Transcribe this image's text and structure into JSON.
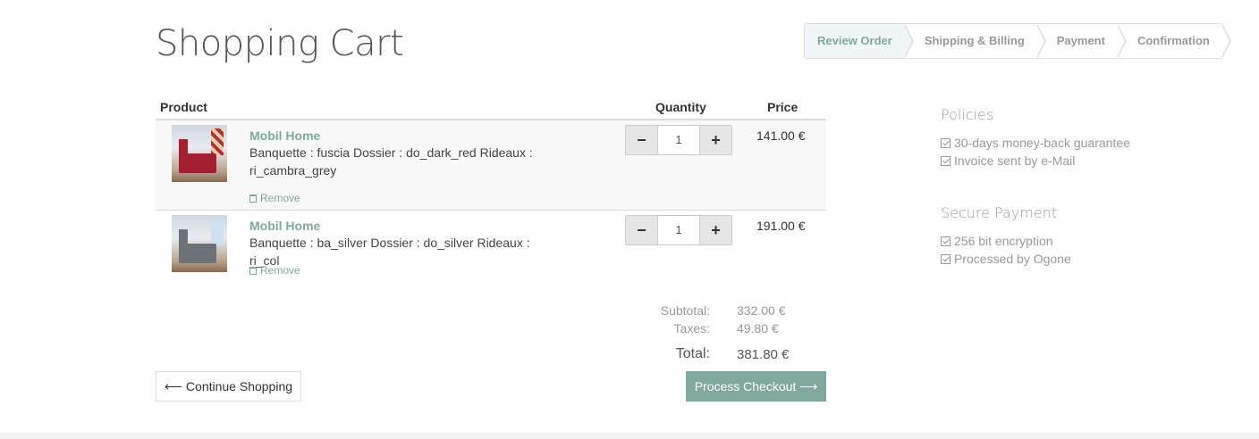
{
  "page": {
    "title": "Shopping Cart"
  },
  "wizard": {
    "steps": [
      "Review Order",
      "Shipping & Billing",
      "Payment",
      "Confirmation"
    ]
  },
  "table": {
    "headers": {
      "product": "Product",
      "quantity": "Quantity",
      "price": "Price"
    }
  },
  "items": [
    {
      "name": "Mobil Home",
      "description": "Banquette : fuscia Dossier : do_dark_red Rideaux : ri_cambra_grey",
      "quantity": "1",
      "price": "141.00 €",
      "remove_label": "Remove"
    },
    {
      "name": "Mobil Home",
      "description": "Banquette : ba_silver Dossier : do_silver Rideaux : ri_col",
      "quantity": "1",
      "price": "191.00 €",
      "remove_label": "Remove"
    }
  ],
  "totals": {
    "subtotal_label": "Subtotal:",
    "subtotal": "332.00 €",
    "taxes_label": "Taxes:",
    "taxes": "49.80 €",
    "total_label": "Total:",
    "total": "381.80 €"
  },
  "buttons": {
    "continue": "⟵ Continue Shopping",
    "checkout": "Process Checkout ⟶"
  },
  "side": {
    "policies_title": "Policies",
    "policies": [
      "30-days money-back guarantee",
      "Invoice sent by e-Mail"
    ],
    "payment_title": "Secure Payment",
    "payment": [
      "256 bit encryption",
      "Processed by Ogone"
    ]
  },
  "colors": {
    "accent": "#7fa99e"
  }
}
